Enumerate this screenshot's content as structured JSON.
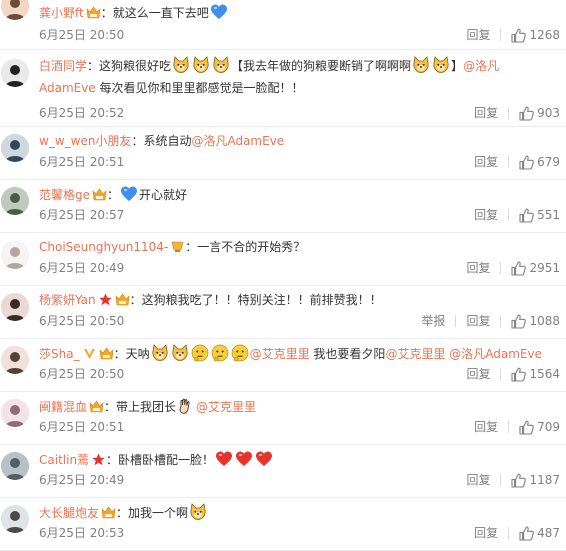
{
  "comments": [
    {
      "user": "龚小野ft",
      "badge": "vip",
      "segments": [
        {
          "t": "text",
          "v": "：就这么一直下去吧"
        },
        {
          "t": "emoji",
          "v": "blue-heart"
        }
      ],
      "time": "6月25日 20:50",
      "reply": "回复",
      "likes": "1268"
    },
    {
      "user": "白酒同学",
      "badge": "",
      "segments": [
        {
          "t": "text",
          "v": "：这狗粮很好吃"
        },
        {
          "t": "emoji",
          "v": "doge"
        },
        {
          "t": "emoji",
          "v": "doge"
        },
        {
          "t": "emoji",
          "v": "doge"
        },
        {
          "t": "text",
          "v": "【我去年做的狗粮要断销了啊啊啊"
        },
        {
          "t": "emoji",
          "v": "doge"
        },
        {
          "t": "emoji",
          "v": "doge"
        },
        {
          "t": "text",
          "v": "】"
        },
        {
          "t": "mention",
          "v": "@洛凡"
        }
      ],
      "line2": [
        {
          "t": "mention",
          "v": "AdamEve"
        },
        {
          "t": "text",
          "v": " 每次看见你和里里都感觉是一脸配！！"
        }
      ],
      "time": "6月25日 20:52",
      "reply": "回复",
      "likes": "903"
    },
    {
      "user": "w_w_wen小朋友",
      "badge": "",
      "segments": [
        {
          "t": "text",
          "v": "：系统自动"
        },
        {
          "t": "mention",
          "v": "@洛凡AdamEve"
        }
      ],
      "time": "6月25日 20:51",
      "reply": "回复",
      "likes": "679"
    },
    {
      "user": "范馨格ge",
      "badge": "vip",
      "segments": [
        {
          "t": "text",
          "v": "："
        },
        {
          "t": "emoji",
          "v": "blue-heart"
        },
        {
          "t": "text",
          "v": "开心就好"
        }
      ],
      "time": "6月25日 20:57",
      "reply": "回复",
      "likes": "551"
    },
    {
      "user": "ChoiSeunghyun1104-",
      "badge": "gold",
      "segments": [
        {
          "t": "text",
          "v": "：一言不合的开始秀？"
        }
      ],
      "time": "6月25日 20:49",
      "reply": "回复",
      "likes": "2951"
    },
    {
      "user": "杨紫妍Yan",
      "badge": "star-vip",
      "segments": [
        {
          "t": "text",
          "v": "：这狗粮我吃了！！特别关注！！前排赞我！！"
        }
      ],
      "time": "6月25日 20:50",
      "report": "举报",
      "reply": "回复",
      "likes": "1088"
    },
    {
      "user": "莎Sha_",
      "badge": "v-vip",
      "segments": [
        {
          "t": "text",
          "v": "：天呐"
        },
        {
          "t": "emoji",
          "v": "doge"
        },
        {
          "t": "emoji",
          "v": "doge"
        },
        {
          "t": "emoji",
          "v": "think"
        },
        {
          "t": "emoji",
          "v": "think"
        },
        {
          "t": "emoji",
          "v": "think"
        },
        {
          "t": "mention",
          "v": "@艾克里里"
        },
        {
          "t": "text",
          "v": " 我也要看夕阳"
        },
        {
          "t": "mention",
          "v": "@艾克里里"
        },
        {
          "t": "text",
          "v": " "
        },
        {
          "t": "mention",
          "v": "@洛凡AdamEve"
        }
      ],
      "time": "6月25日 20:50",
      "reply": "回复",
      "likes": "1564"
    },
    {
      "user": "闽籍混血",
      "badge": "vip",
      "segments": [
        {
          "t": "text",
          "v": "：带上我团长"
        },
        {
          "t": "emoji",
          "v": "hand"
        },
        {
          "t": "mention",
          "v": "@艾克里里"
        }
      ],
      "time": "6月25日 20:51",
      "reply": "回复",
      "likes": "709"
    },
    {
      "user": "Caitlin蔫",
      "badge": "star",
      "segments": [
        {
          "t": "text",
          "v": "：卧槽卧槽配一脸！"
        },
        {
          "t": "emoji",
          "v": "red-heart"
        },
        {
          "t": "emoji",
          "v": "red-heart"
        },
        {
          "t": "emoji",
          "v": "red-heart"
        }
      ],
      "time": "6月25日 20:49",
      "reply": "回复",
      "likes": "1187"
    },
    {
      "user": "大长腿炮友",
      "badge": "vip",
      "segments": [
        {
          "t": "text",
          "v": "：加我一个啊"
        },
        {
          "t": "emoji",
          "v": "doge"
        }
      ],
      "time": "6月25日 20:53",
      "reply": "回复",
      "likes": "487"
    }
  ],
  "colors": {
    "username": "#eb7350",
    "mention": "#eb7350",
    "meta": "#808080",
    "text": "#333333",
    "divider": "#ececec"
  }
}
